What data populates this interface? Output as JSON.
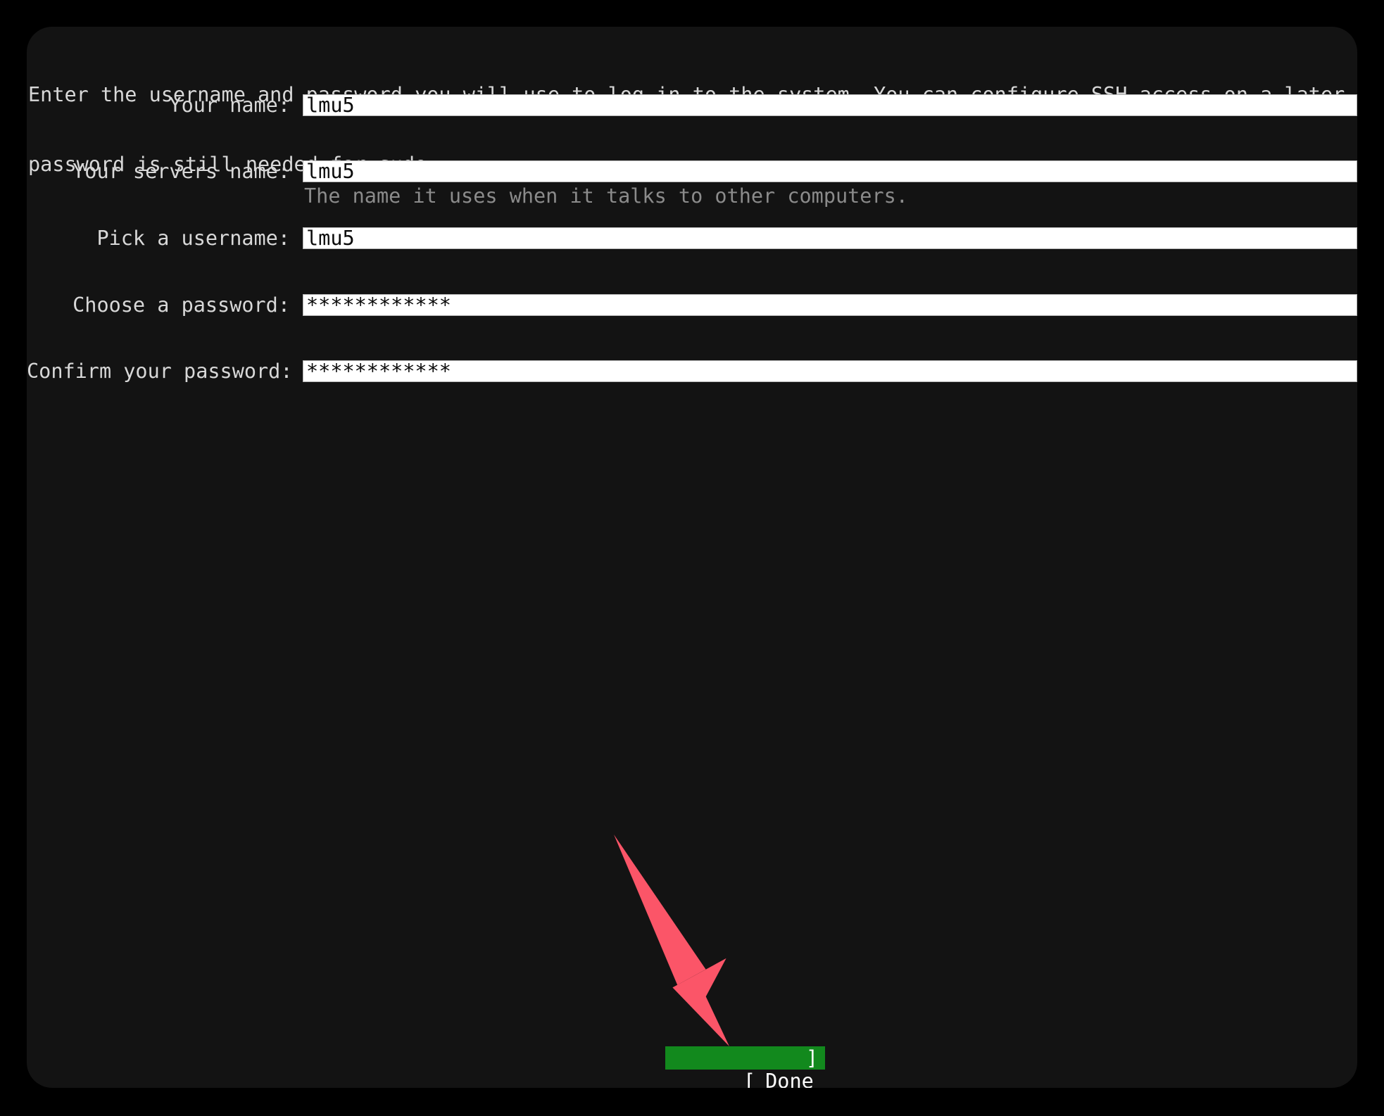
{
  "screen": {
    "background_color": "#000000",
    "panel_color": "#131313",
    "text_color": "#d8d8d8",
    "hint_color": "#8b8b8b"
  },
  "intro": {
    "line1": "Enter the username and password you will use to log in to the system. You can configure SSH access on a later screen b",
    "line2": "password is still needed for sudo."
  },
  "form": {
    "rows": [
      {
        "label": "Your name:",
        "value": "lmu5",
        "hint": "",
        "masked": false
      },
      {
        "label": "Your servers name:",
        "value": "lmu5",
        "hint": "The name it uses when it talks to other computers.",
        "masked": false
      },
      {
        "label": "Pick a username:",
        "value": "lmu5",
        "hint": "",
        "masked": false
      },
      {
        "label": "Choose a password:",
        "value": "************",
        "hint": "",
        "masked": true
      },
      {
        "label": "Confirm your password:",
        "value": "************",
        "hint": "",
        "masked": true
      }
    ]
  },
  "done_button": {
    "bracket_left": "[",
    "label": "Done",
    "bracket_right": "]",
    "background_color": "#12891d",
    "text_color": "#ffffff"
  },
  "annotation": {
    "arrow_color": "#fb5568",
    "arrow_points_to": "done-button"
  }
}
